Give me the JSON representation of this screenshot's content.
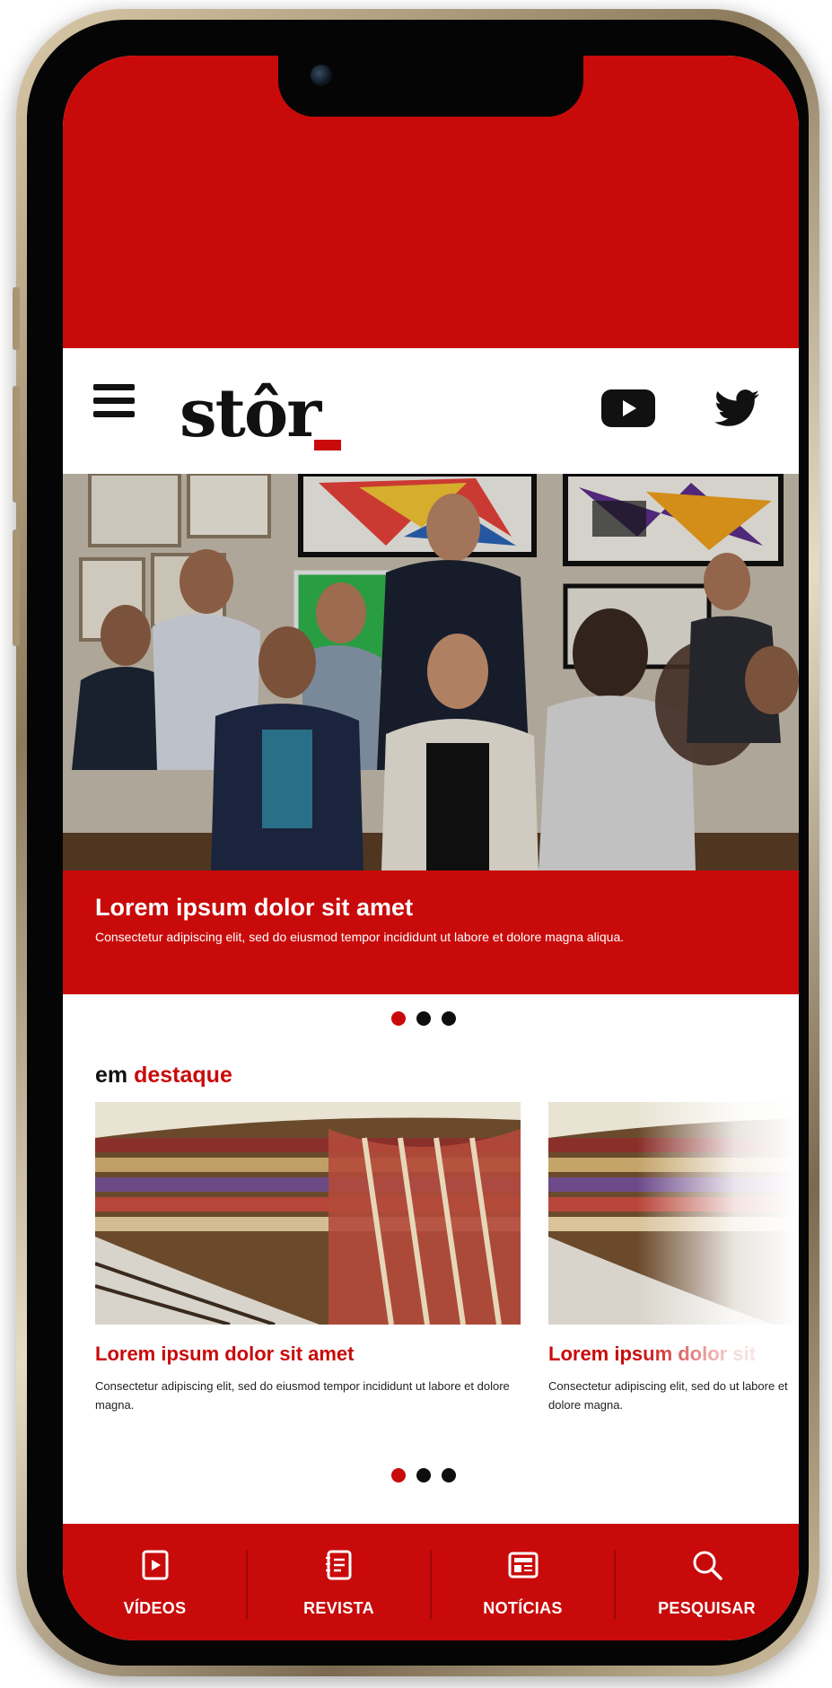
{
  "app": {
    "logo_text": "stôr"
  },
  "colors": {
    "brand_red": "#c90a0a",
    "text_dark": "#111111",
    "background": "#ffffff"
  },
  "header": {
    "menu_icon": "hamburger-icon",
    "social": [
      {
        "name": "youtube-icon"
      },
      {
        "name": "twitter-icon"
      }
    ]
  },
  "hero": {
    "title": "Lorem ipsum dolor sit amet",
    "subtitle": "Consectetur adipiscing elit, sed do eiusmod tempor incididunt ut labore et dolore magna aliqua."
  },
  "section": {
    "title_prefix": "em",
    "title_accent": "destaque"
  },
  "cards": [
    {
      "title": "Lorem ipsum dolor sit amet",
      "text": "Consectetur adipiscing elit, sed do eiusmod tempor incididunt ut labore et dolore magna."
    },
    {
      "title": "Lorem ipsum dolor sit",
      "text": "Consectetur adipiscing elit, sed do ut labore et dolore magna."
    }
  ],
  "nav": [
    {
      "label": "VÍDEOS",
      "icon": "video-icon"
    },
    {
      "label": "REVISTA",
      "icon": "magazine-icon"
    },
    {
      "label": "NOTÍCIAS",
      "icon": "newspaper-icon"
    },
    {
      "label": "PESQUISAR",
      "icon": "search-icon"
    }
  ]
}
